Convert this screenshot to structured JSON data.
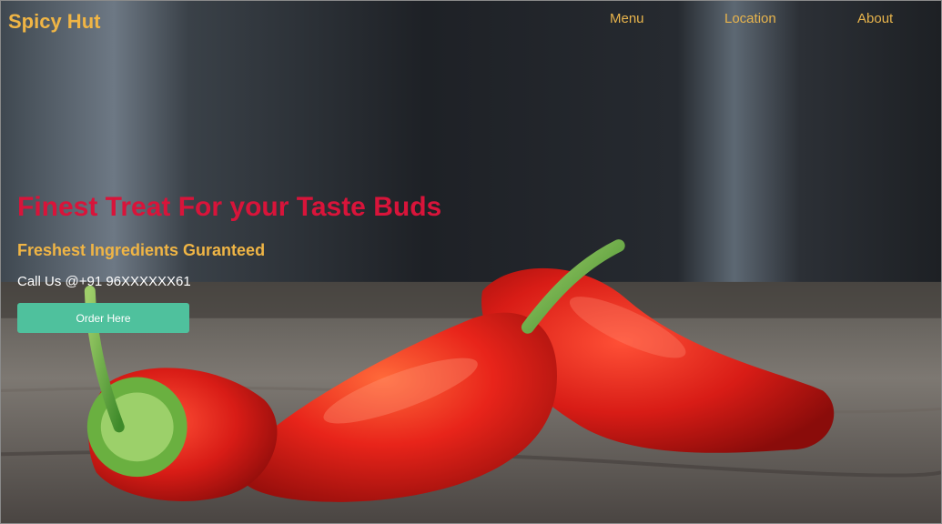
{
  "navbar": {
    "brand": "Spicy Hut",
    "links": [
      {
        "label": "Menu"
      },
      {
        "label": "Location"
      },
      {
        "label": "About"
      }
    ]
  },
  "hero": {
    "title": "Finest Treat For your Taste Buds",
    "subtitle": "Freshest Ingredients Guranteed",
    "phone": "Call Us @+91 96XXXXXX61",
    "cta_label": "Order Here"
  },
  "colors": {
    "brand": "#f0b545",
    "title": "#d8143a",
    "cta": "#4fc19d"
  }
}
